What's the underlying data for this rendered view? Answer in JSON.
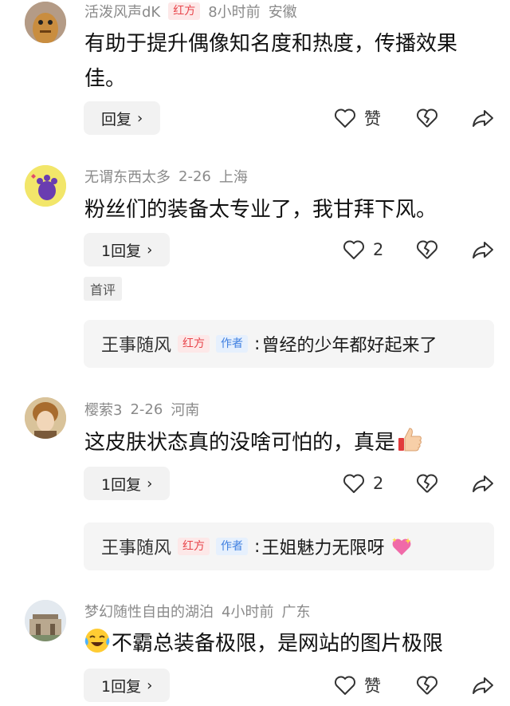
{
  "comments": [
    {
      "user": "活泼风声dK",
      "badge": "红方",
      "time": "8小时前",
      "location": "安徽",
      "text": "有助于提升偶像知名度和热度，传播效果佳。",
      "reply_label": "回复",
      "like_label": "赞"
    },
    {
      "user": "无谓东西太多",
      "time": "2-26",
      "location": "上海",
      "text": "粉丝们的装备太专业了，我甘拜下风。",
      "reply_label": "1回复",
      "like_count": "2",
      "first_tag": "首评",
      "sub_reply": {
        "user": "王事随风",
        "badge": "红方",
        "author_tag": "作者",
        "text": "曾经的少年都好起来了"
      }
    },
    {
      "user": "樱萦3",
      "time": "2-26",
      "location": "河南",
      "text": "这皮肤状态真的没啥可怕的，真是",
      "text_emoji": "thumbs-up-emoji",
      "reply_label": "1回复",
      "like_count": "2",
      "sub_reply": {
        "user": "王事随风",
        "badge": "红方",
        "author_tag": "作者",
        "text": "王姐魅力无限呀",
        "emoji": "sparkling-heart-emoji"
      }
    },
    {
      "user": "梦幻随性自由的湖泊",
      "time": "4小时前",
      "location": "广东",
      "text": "不霸总装备极限，是网站的图片极限",
      "text_emoji": "crying-laughing-emoji",
      "reply_label": "1回复",
      "like_label": "赞"
    }
  ],
  "colors": {
    "badge_red": "#e8454b",
    "badge_blue": "#3f7fe0",
    "meta_gray": "#8a8a8a"
  },
  "icons": [
    "heart-icon",
    "broken-heart-icon",
    "share-icon",
    "chevron-right-icon"
  ]
}
